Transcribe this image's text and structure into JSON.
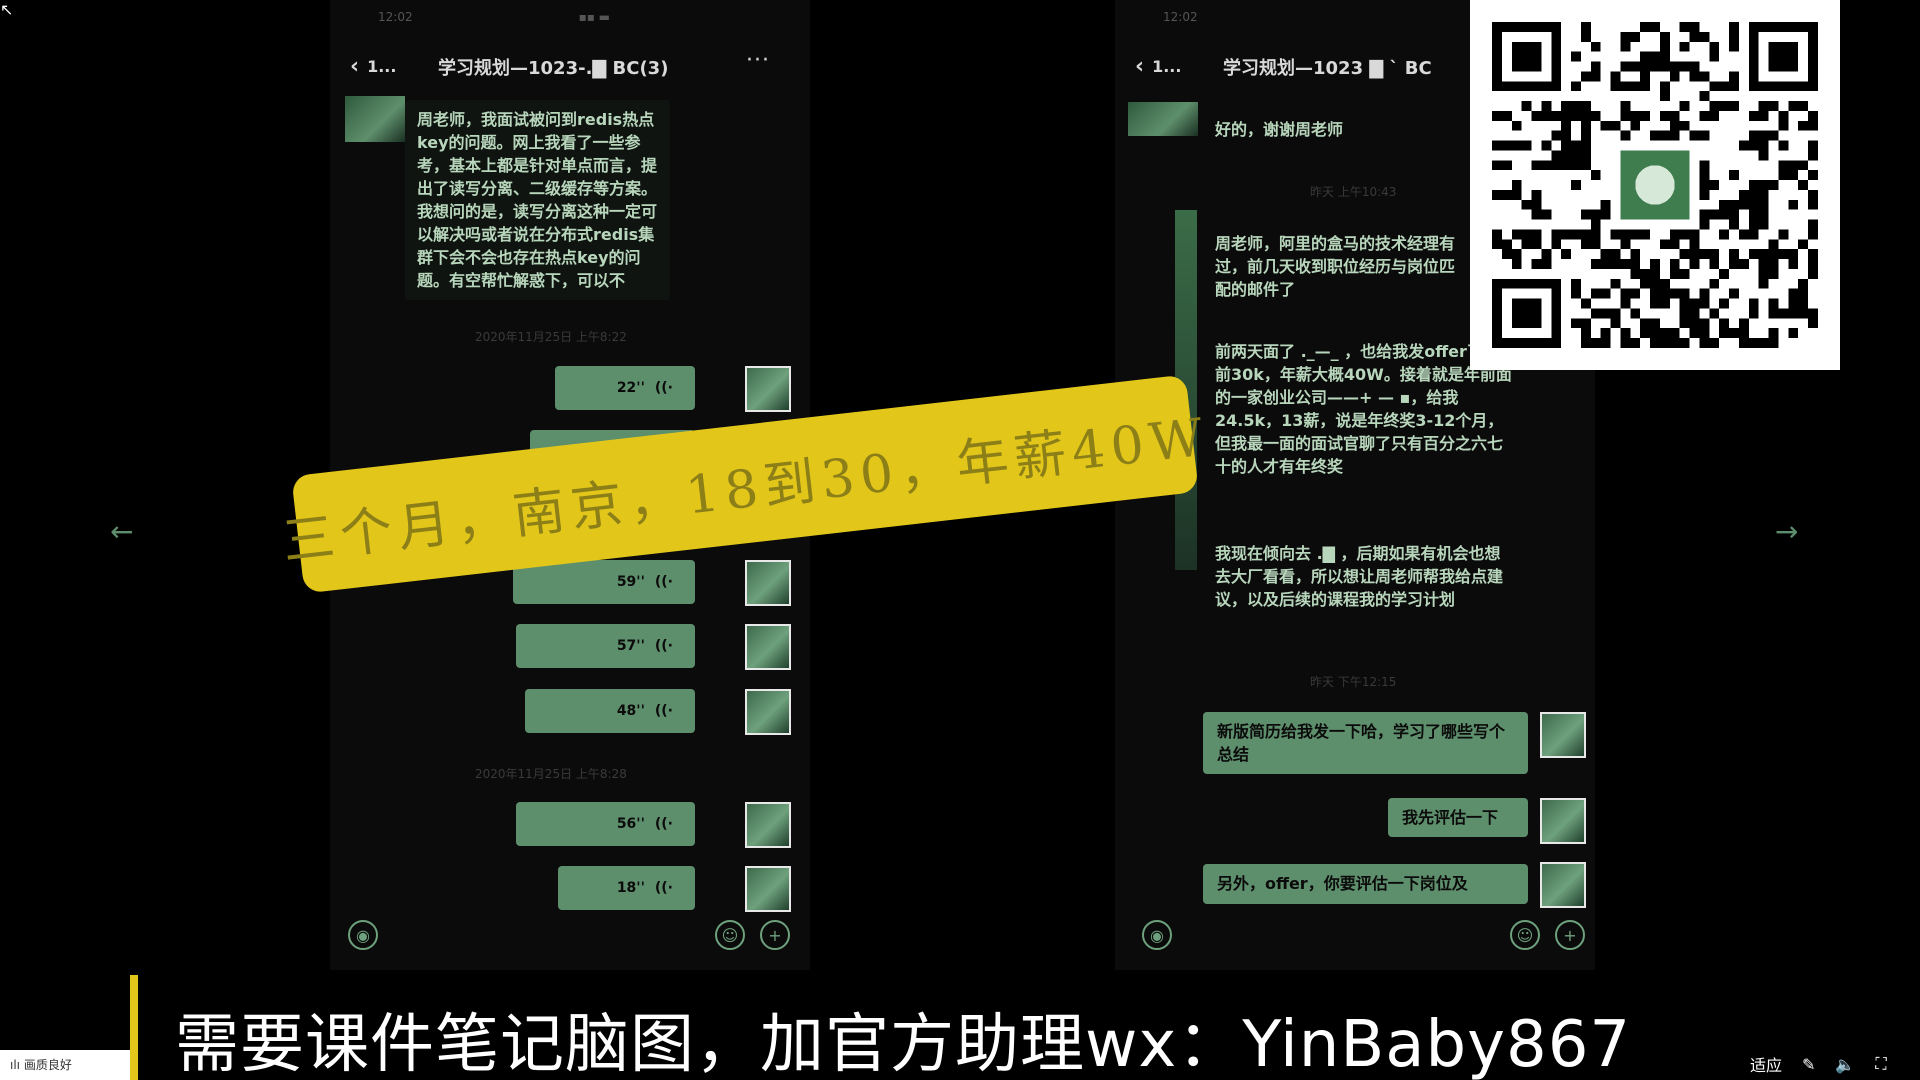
{
  "left_chat": {
    "status_time": "12:02",
    "status_icons": "▪▪ ▬",
    "back_label": "1...",
    "title": "学习规划—1023-.▇ BC(3)",
    "more_label": "···",
    "incoming_message": "周老师，我面试被问到redis热点key的问题。网上我看了一些参考，基本上都是针对单点而言，提出了读写分离、二级缓存等方案。我想问的是，读写分离这种一定可以解决吗或者说在分布式redis集群下会不会也存在热点key的问题。有空帮忙解惑下，可以不",
    "timestamp_1": "2020年11月25日 上午8:22",
    "voices": [
      {
        "duration": "22''"
      },
      {
        "duration": "59''"
      },
      {
        "duration": "57''"
      },
      {
        "duration": "48''"
      }
    ],
    "timestamp_2": "2020年11月25日 上午8:28",
    "voices_2": [
      {
        "duration": "56''"
      },
      {
        "duration": "18''"
      }
    ]
  },
  "right_chat": {
    "status_time": "12:02",
    "back_label": "1...",
    "title": "学习规划—1023 ▇ ` BC",
    "msg_1": "好的，谢谢周老师",
    "timestamp_1": "昨天 上午10:43",
    "msg_2": "周老师，阿里的盒马的技术经理有过，前几天收到职位经历与岗位匹配的邮件了",
    "msg_3": "前两天面了 ._—_ ，也给我发offer了，税前30k，年薪大概40W。接着就是年前面的一家创业公司——+ — ▪，给我24.5k，13薪，说是年终奖3-12个月，但我最一面的面试官聊了只有百分之六七十的人才有年终奖",
    "msg_4": "我现在倾向去 .▇ ，后期如果有机会也想去大厂看看，所以想让周老师帮我给点建议，以及后续的课程我的学习计划",
    "timestamp_2": "昨天 下午12:15",
    "out_1": "新版简历给我发一下哈，学习了哪些写个总结",
    "out_2": "我先评估一下",
    "out_3": "另外，offer，你要评估一下岗位及"
  },
  "overlay": {
    "banner_text": "三个月，南京，18到30，年薪40W"
  },
  "nav": {
    "prev_arrow": "←",
    "next_arrow": "→"
  },
  "caption": {
    "text": "需要课件笔记脑图，加官方助理wx：YinBaby867"
  },
  "taskbar": {
    "left_label": "ılı 画质良好",
    "right_label": "适应",
    "icons": [
      "✎",
      "🔈",
      "⛶"
    ]
  },
  "colors": {
    "bubble_green": "#5e8f6c",
    "text_green": "#b8d6bc",
    "banner_yellow": "#e2c71a",
    "background": "#000000"
  }
}
